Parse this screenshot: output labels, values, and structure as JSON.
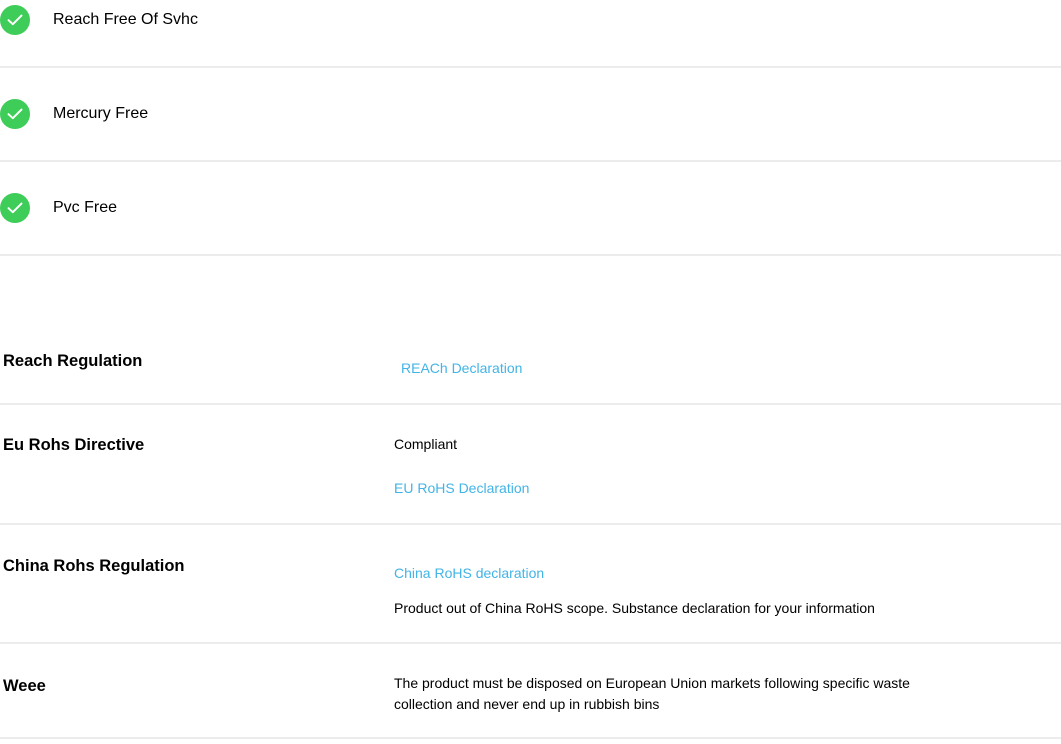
{
  "features": [
    {
      "label": "Reach Free Of Svhc",
      "icon": "check-circle-icon"
    },
    {
      "label": "Mercury Free",
      "icon": "check-circle-icon"
    },
    {
      "label": "Pvc Free",
      "icon": "check-circle-icon"
    }
  ],
  "regulations": {
    "reach": {
      "title": "Reach Regulation",
      "link": "REACh Declaration"
    },
    "eu_rohs": {
      "title": "Eu Rohs Directive",
      "status": "Compliant",
      "link": "EU RoHS Declaration"
    },
    "china_rohs": {
      "title": "China Rohs Regulation",
      "link": "China RoHS declaration",
      "note": "Product out of China RoHS scope. Substance declaration for your information"
    },
    "weee": {
      "title": "Weee",
      "note_line1": "The product must be disposed on European Union markets following specific waste",
      "note_line2": "collection and never end up in rubbish bins"
    }
  },
  "colors": {
    "check_green": "#3dcd58",
    "link_blue": "#42b4e6",
    "divider": "#ececec"
  }
}
